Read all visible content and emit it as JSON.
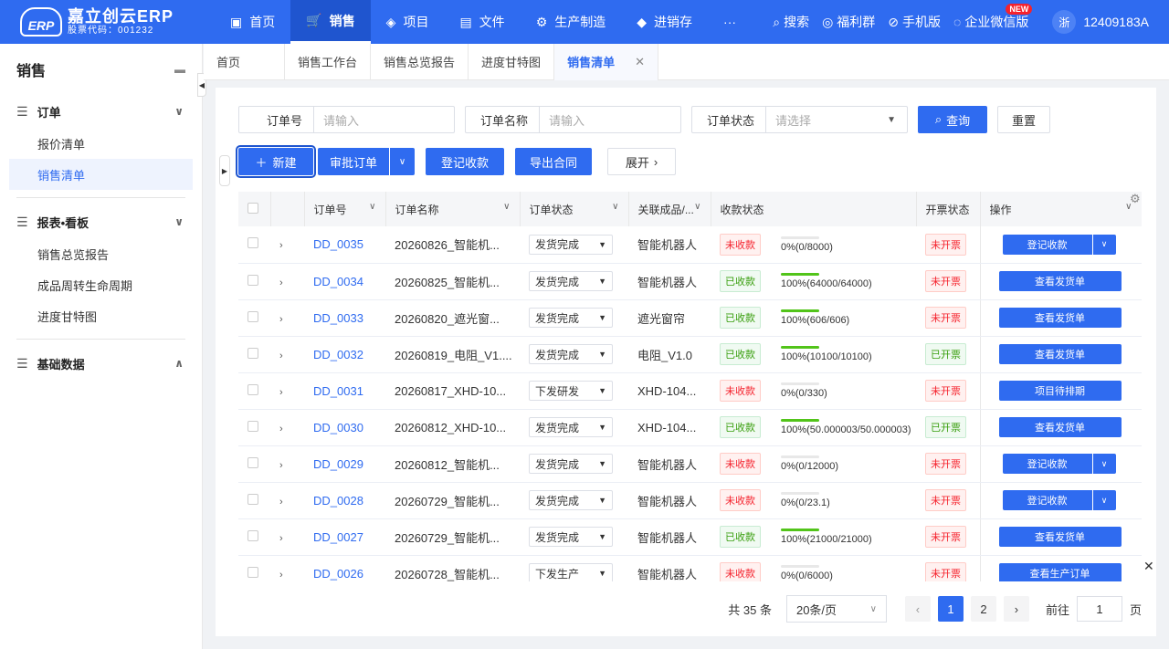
{
  "brand": {
    "title": "嘉立创云ERP",
    "subtitle": "股票代码：001232",
    "mark": "ERP"
  },
  "nav": [
    {
      "label": "首页",
      "icon": "monitor-icon",
      "glyph": "▣"
    },
    {
      "label": "销售",
      "icon": "cart-icon",
      "glyph": "🛒"
    },
    {
      "label": "项目",
      "icon": "layers-icon",
      "glyph": "◈"
    },
    {
      "label": "文件",
      "icon": "folder-icon",
      "glyph": "▤"
    },
    {
      "label": "生产制造",
      "icon": "gear-icon",
      "glyph": "⚙"
    },
    {
      "label": "进销存",
      "icon": "box-icon",
      "glyph": "◆"
    },
    {
      "label": "···",
      "icon": "more-icon",
      "glyph": ""
    }
  ],
  "tools": {
    "search": "搜索",
    "welfare": "福利群",
    "mobile": "手机版",
    "wechat": "企业微信版",
    "new_badge": "NEW",
    "avatar": "浙",
    "user": "12409183A"
  },
  "sidebar": {
    "title": "销售",
    "groups": [
      {
        "label": "订单",
        "items": [
          "报价清单",
          "销售清单"
        ]
      },
      {
        "label": "报表•看板",
        "items": [
          "销售总览报告",
          "成品周转生命周期",
          "进度甘特图"
        ]
      },
      {
        "label": "基础数据",
        "items": []
      }
    ]
  },
  "tabs": [
    "首页",
    "销售工作台",
    "销售总览报告",
    "进度甘特图",
    "销售清单"
  ],
  "filters": {
    "order_no": {
      "label": "订单号",
      "placeholder": "请输入"
    },
    "order_name": {
      "label": "订单名称",
      "placeholder": "请输入"
    },
    "order_status": {
      "label": "订单状态",
      "placeholder": "请选择"
    },
    "query": "查询",
    "reset": "重置"
  },
  "actions": {
    "new": "新建",
    "approve": "审批订单",
    "register": "登记收款",
    "export": "导出合同",
    "expand": "展开"
  },
  "columns": [
    "订单号",
    "订单名称",
    "订单状态",
    "关联成品/...",
    "收款状态",
    "开票状态",
    "操作"
  ],
  "rows": [
    {
      "no": "DD_0035",
      "name": "20260826_智能机...",
      "status": "发货完成",
      "product": "智能机器人",
      "pay": "未收款",
      "progress": "0%(0/8000)",
      "pct": 0,
      "invoice": "未开票",
      "op": "登记收款",
      "split": true
    },
    {
      "no": "DD_0034",
      "name": "20260825_智能机...",
      "status": "发货完成",
      "product": "智能机器人",
      "pay": "已收款",
      "progress": "100%(64000/64000)",
      "pct": 100,
      "invoice": "未开票",
      "op": "查看发货单",
      "split": false
    },
    {
      "no": "DD_0033",
      "name": "20260820_遮光窗...",
      "status": "发货完成",
      "product": "遮光窗帘",
      "pay": "已收款",
      "progress": "100%(606/606)",
      "pct": 100,
      "invoice": "未开票",
      "op": "查看发货单",
      "split": false
    },
    {
      "no": "DD_0032",
      "name": "20260819_电阻_V1....",
      "status": "发货完成",
      "product": "电阻_V1.0",
      "pay": "已收款",
      "progress": "100%(10100/10100)",
      "pct": 100,
      "invoice": "已开票",
      "op": "查看发货单",
      "split": false
    },
    {
      "no": "DD_0031",
      "name": "20260817_XHD-10...",
      "status": "下发研发",
      "product": "XHD-104...",
      "pay": "未收款",
      "progress": "0%(0/330)",
      "pct": 0,
      "invoice": "未开票",
      "op": "项目待排期",
      "split": false
    },
    {
      "no": "DD_0030",
      "name": "20260812_XHD-10...",
      "status": "发货完成",
      "product": "XHD-104...",
      "pay": "已收款",
      "progress": "100%(50.000003/50.000003)",
      "pct": 100,
      "invoice": "已开票",
      "op": "查看发货单",
      "split": false
    },
    {
      "no": "DD_0029",
      "name": "20260812_智能机...",
      "status": "发货完成",
      "product": "智能机器人",
      "pay": "未收款",
      "progress": "0%(0/12000)",
      "pct": 0,
      "invoice": "未开票",
      "op": "登记收款",
      "split": true
    },
    {
      "no": "DD_0028",
      "name": "20260729_智能机...",
      "status": "发货完成",
      "product": "智能机器人",
      "pay": "未收款",
      "progress": "0%(0/23.1)",
      "pct": 0,
      "invoice": "未开票",
      "op": "登记收款",
      "split": true
    },
    {
      "no": "DD_0027",
      "name": "20260729_智能机...",
      "status": "发货完成",
      "product": "智能机器人",
      "pay": "已收款",
      "progress": "100%(21000/21000)",
      "pct": 100,
      "invoice": "未开票",
      "op": "查看发货单",
      "split": false
    },
    {
      "no": "DD_0026",
      "name": "20260728_智能机...",
      "status": "下发生产",
      "product": "智能机器人",
      "pay": "未收款",
      "progress": "0%(0/6000)",
      "pct": 0,
      "invoice": "未开票",
      "op": "查看生产订单",
      "split": false
    }
  ],
  "pager": {
    "total": "共 35 条",
    "size": "20条/页",
    "pages": [
      "1",
      "2"
    ],
    "goto_label": "前往",
    "goto_value": "1",
    "page_unit": "页"
  }
}
